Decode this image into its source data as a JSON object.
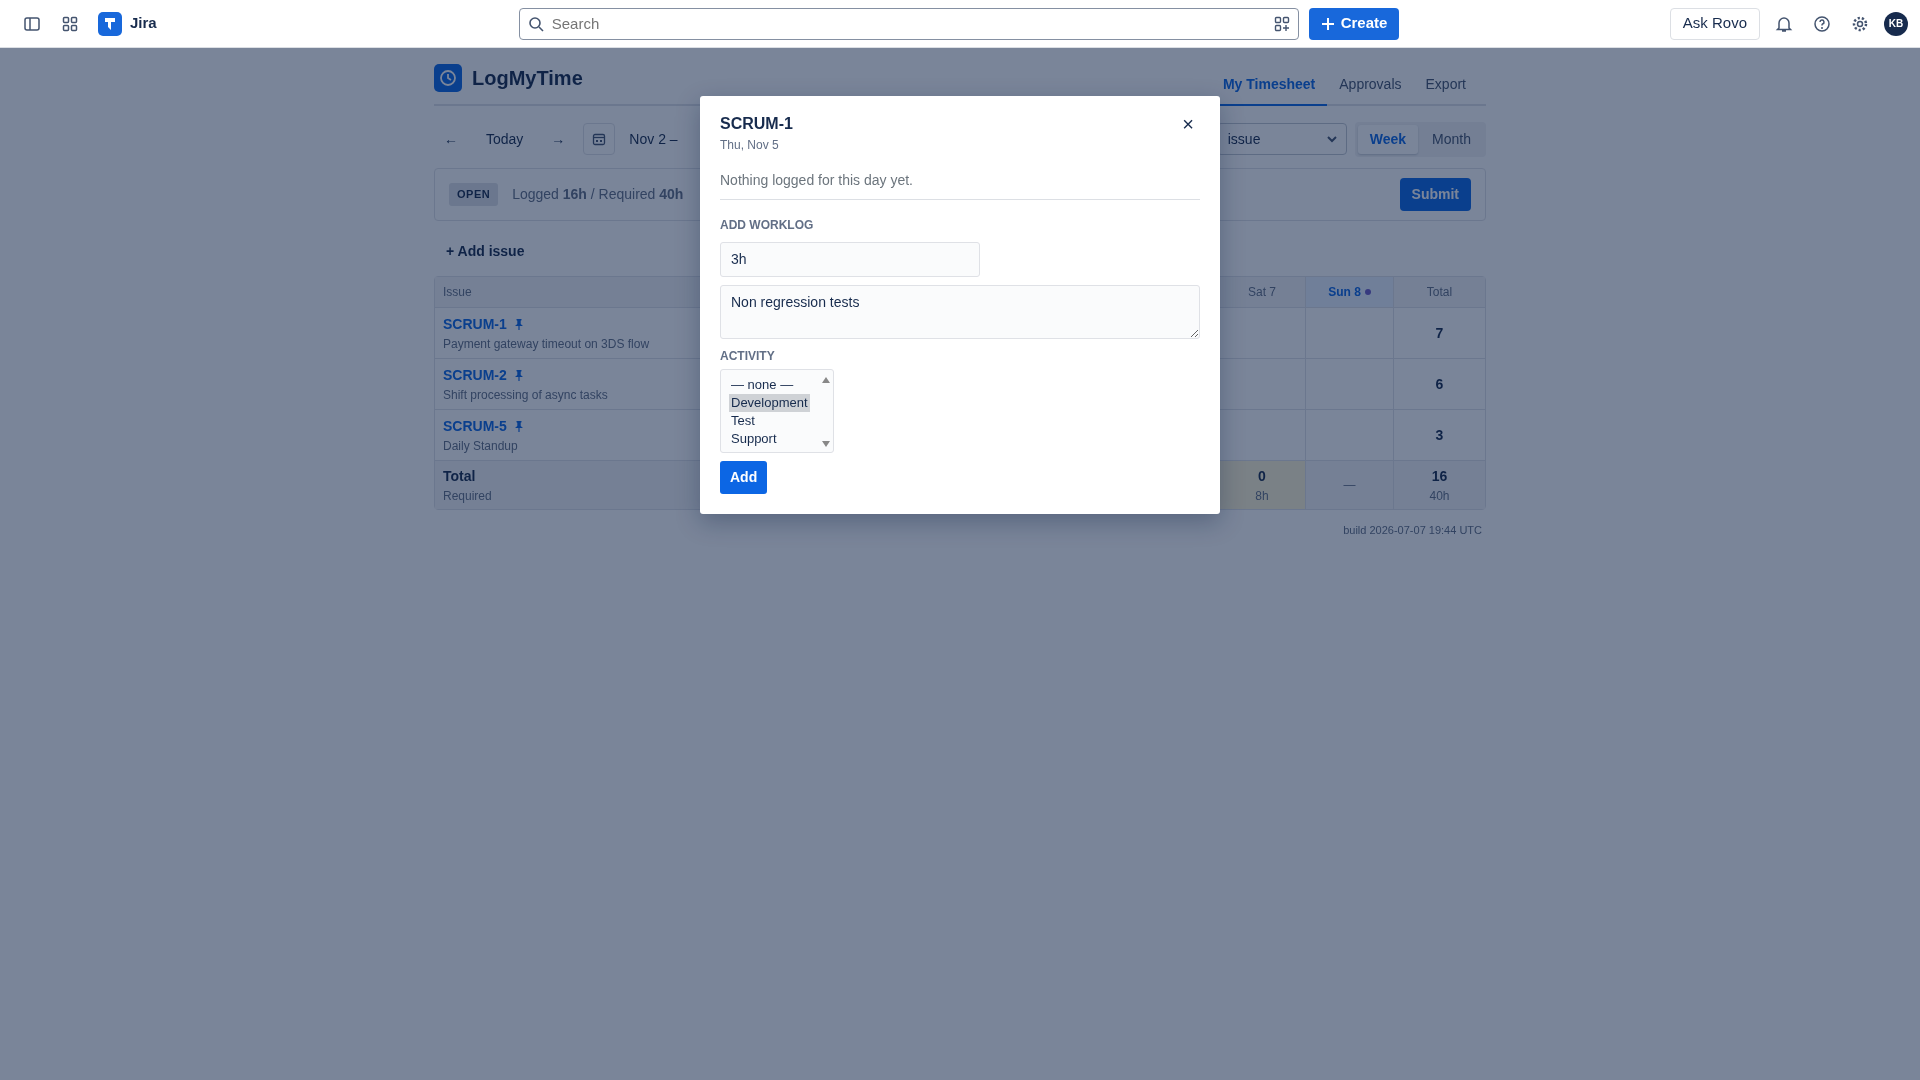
{
  "topbar": {
    "product": "Jira",
    "search": {
      "placeholder": "Search"
    },
    "create_button": "Create",
    "ask_button": "Ask Rovo",
    "avatar": "KB"
  },
  "app": {
    "title": "LogMyTime",
    "tabs": [
      {
        "label": "My Timesheet",
        "selected": true
      },
      {
        "label": "Approvals",
        "selected": false
      },
      {
        "label": "Export",
        "selected": false
      }
    ]
  },
  "toolbar": {
    "prev": "←",
    "today": "Today",
    "next": "→",
    "range": "Nov 2 –",
    "filter": "issue",
    "views": [
      {
        "label": "Week",
        "selected": true
      },
      {
        "label": "Month",
        "selected": false
      }
    ]
  },
  "status": {
    "badge": "OPEN",
    "summary": "Logged **16h** / Required **40h**",
    "submit": "Submit"
  },
  "add_issue": "+ Add issue",
  "table": {
    "columns": [
      {
        "label": "Issue",
        "today": false
      },
      {
        "label": "Sat 7",
        "today": false
      },
      {
        "label": "Sun 8",
        "today": true
      },
      {
        "label": "Total",
        "today": false
      }
    ],
    "rows": [
      {
        "key": "SCRUM-1",
        "pinned": true,
        "summary": "Payment gateway timeout on 3DS flow",
        "total": "7"
      },
      {
        "key": "SCRUM-2",
        "pinned": true,
        "summary": "Shift processing of async tasks",
        "total": "6"
      },
      {
        "key": "SCRUM-5",
        "pinned": true,
        "summary": "Daily Standup",
        "total": "3"
      }
    ],
    "totals": {
      "label": "Total",
      "sublabel": "Required",
      "days": [
        {
          "value": "0",
          "required": "8h",
          "short": true
        },
        {
          "value": "—",
          "short": false
        }
      ],
      "total": "16",
      "required": "40h"
    }
  },
  "footer": "build 2026-07-07 19:44 UTC",
  "dialog": {
    "title": "SCRUM-1",
    "date": "Thu, Nov 5",
    "close": "×",
    "empty_message": "Nothing logged for this day yet.",
    "section": "ADD WORKLOG",
    "duration": {
      "value": "3h"
    },
    "comment": {
      "value": "Non regression tests"
    },
    "activity_label": "ACTIVITY",
    "activities": [
      {
        "label": "— none —",
        "selected": false
      },
      {
        "label": "Development",
        "selected": true
      },
      {
        "label": "Test",
        "selected": false
      },
      {
        "label": "Support",
        "selected": false
      }
    ],
    "add_button": "Add"
  }
}
